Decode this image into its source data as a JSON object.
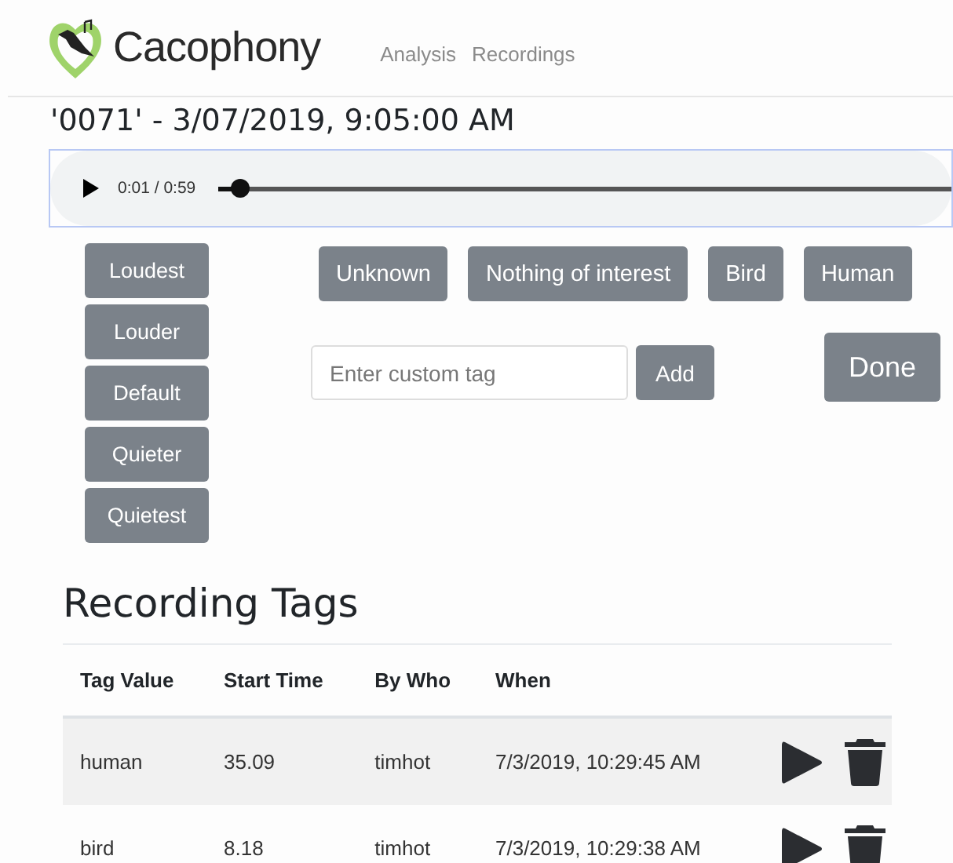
{
  "header": {
    "brand": "Cacophony",
    "nav": [
      "Analysis",
      "Recordings"
    ]
  },
  "title": "'0071' - 3/07/2019, 9:05:00 AM",
  "audio": {
    "time": "0:01 / 0:59",
    "level": 0.03
  },
  "volume_buttons": [
    "Loudest",
    "Louder",
    "Default",
    "Quieter",
    "Quietest"
  ],
  "tag_buttons": [
    "Unknown",
    "Nothing of interest",
    "Bird",
    "Human"
  ],
  "custom_tag": {
    "placeholder": "Enter custom tag",
    "button": "Add"
  },
  "done_button": "Done",
  "tags_section": {
    "heading": "Recording Tags",
    "columns": [
      "Tag Value",
      "Start Time",
      "By Who",
      "When"
    ],
    "rows": [
      {
        "cells": [
          "human",
          "35.09",
          "timhot",
          "7/3/2019, 10:29:45 AM"
        ]
      },
      {
        "cells": [
          "bird",
          "8.18",
          "timhot",
          "7/3/2019, 10:29:38 AM"
        ]
      }
    ]
  }
}
